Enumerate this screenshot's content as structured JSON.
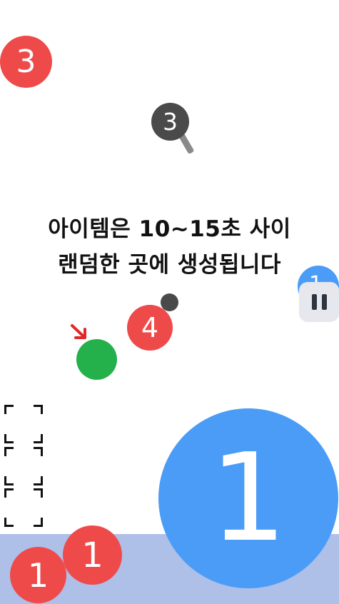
{
  "tutorial": {
    "line1": "아이템은 10~15초 사이",
    "line2": "랜덤한 곳에 생성됩니다"
  },
  "balls": {
    "red_top_left": "3",
    "magnifier": "3",
    "blue_edge": "1",
    "red_mid": "4",
    "big_blue": "1",
    "red_bottom_a": "1",
    "red_bottom_b": "1"
  },
  "icons": {
    "pause": "pause-icon",
    "magnifier": "magnifier-icon",
    "aim_arrow": "arrow-icon",
    "frame_corners": "corner-bracket-icon"
  },
  "colors": {
    "red": "#ef4a4a",
    "blue": "#4a9cf7",
    "dark": "#4a4a4a",
    "green": "#24b04a",
    "floor": "#aebfe8"
  }
}
